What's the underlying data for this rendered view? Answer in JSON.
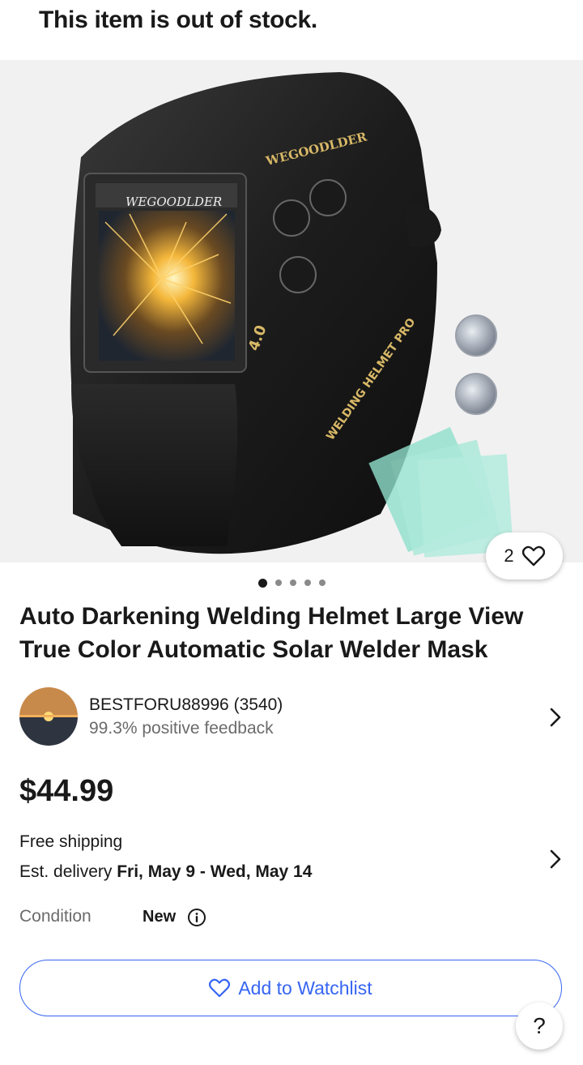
{
  "banner": {
    "text": "This item is out of stock."
  },
  "hero": {
    "brand_text": "WEGOODLDER",
    "visor_text": "WEGOODLDER",
    "model_text": "4.0",
    "side_text": "WELDING HELMET PRO",
    "watch_count": "2",
    "carousel_total": 5,
    "carousel_active": 1
  },
  "product": {
    "title": "Auto Darkening Welding Helmet Large View True Color Automatic Solar Welder Mask"
  },
  "seller": {
    "name": "BESTFORU88996 (3540)",
    "feedback": "99.3% positive feedback"
  },
  "price": "$44.99",
  "shipping": {
    "line1": "Free shipping",
    "est_prefix": "Est. delivery ",
    "est_dates": "Fri, May 9 - Wed, May 14"
  },
  "condition": {
    "label": "Condition",
    "value": "New"
  },
  "actions": {
    "watchlist_label": "Add to Watchlist",
    "help_label": "?"
  },
  "colors": {
    "accent": "#3665f3",
    "text": "#191919",
    "muted": "#6b6b6b"
  }
}
